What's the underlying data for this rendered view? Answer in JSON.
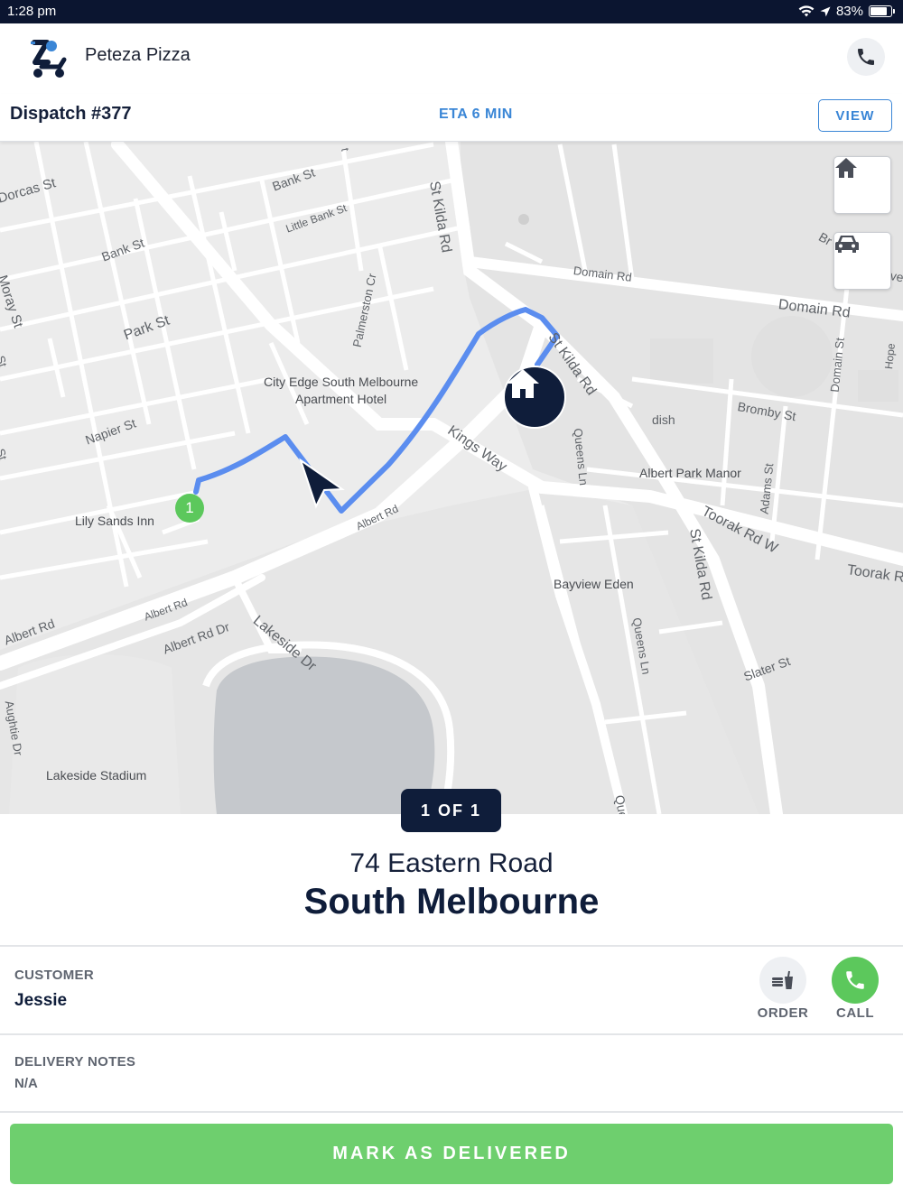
{
  "status_bar": {
    "time": "1:28 pm",
    "battery": "83%",
    "icons": [
      "wifi-icon",
      "location-arrow-icon",
      "battery-icon"
    ]
  },
  "app": {
    "name": "Peteza Pizza",
    "icons": [
      "app-logo",
      "phone-icon"
    ]
  },
  "dispatch": {
    "title": "Dispatch #377",
    "eta": "ETA 6 MIN",
    "view_label": "VIEW"
  },
  "map": {
    "street_labels": [
      "Dorcas St",
      "Bank St",
      "Little Bank St",
      "Bank St",
      "Moray St",
      "Park St",
      "Palmerston Cr",
      "St Kilda Rd",
      "Domain Rd",
      "Domain Rd",
      "City Edge South Melbourne",
      "Apartment Hotel",
      "Napier St",
      "Kings Way",
      "St Kilda Rd",
      "Bromby St",
      "dish",
      "Domain St",
      "Albert Park Manor",
      "Adams St",
      "Queens Ln",
      "Lily Sands Inn",
      "Albert Rd",
      "Toorak Rd W",
      "Toorak R",
      "Albert Rd",
      "Albert Rd",
      "Albert Rd Dr",
      "Lakeside Dr",
      "Bayview Eden",
      "Queens Ln",
      "St Kilda Rd",
      "Slater St",
      "Aughtie Dr",
      "Lakeside Stadium",
      "Que",
      "St",
      "St",
      "t",
      "Br",
      "ve",
      "Hope"
    ],
    "stop_marker": "1",
    "buttons": [
      "home-icon",
      "car-icon"
    ],
    "colors": {
      "route": "#5b8def",
      "marker_green": "#5cc85c",
      "home_marker": "#0f1d3a"
    }
  },
  "pager": "1 OF 1",
  "address": {
    "street": "74 Eastern Road",
    "suburb": "South Melbourne"
  },
  "customer": {
    "label": "CUSTOMER",
    "name": "Jessie",
    "order_label": "ORDER",
    "call_label": "CALL"
  },
  "notes": {
    "label": "DELIVERY NOTES",
    "value": "N/A"
  },
  "action": {
    "label": "MARK AS DELIVERED",
    "color": "#6ecf6e"
  }
}
